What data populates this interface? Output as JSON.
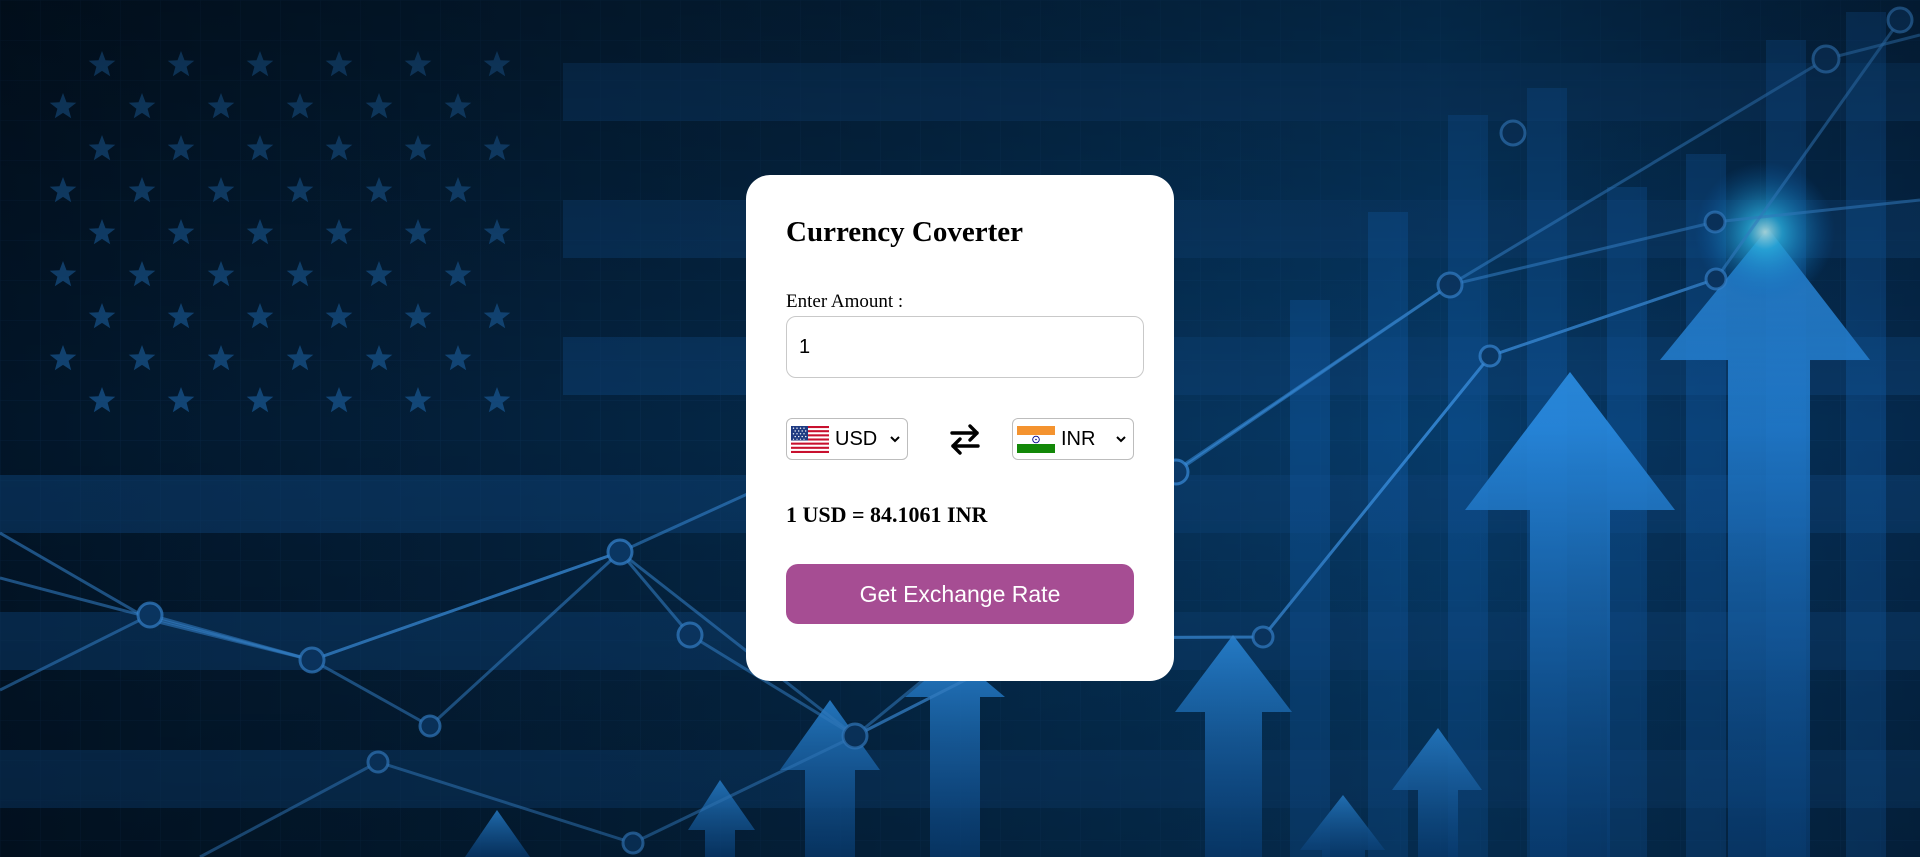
{
  "app": {
    "title": "Currency Coverter"
  },
  "amount": {
    "label": "Enter Amount :",
    "value": "1"
  },
  "from_currency": {
    "code": "USD",
    "flag": "us-flag"
  },
  "to_currency": {
    "code": "INR",
    "flag": "india-flag"
  },
  "swap": {
    "icon": "swap-arrows-icon"
  },
  "result": {
    "text": "1 USD = 84.1061 INR"
  },
  "button": {
    "label": "Get Exchange Rate"
  },
  "colors": {
    "button": "#a64d93",
    "background": "#04203c",
    "card": "#ffffff",
    "accent_glow": "#2ec8ff"
  }
}
